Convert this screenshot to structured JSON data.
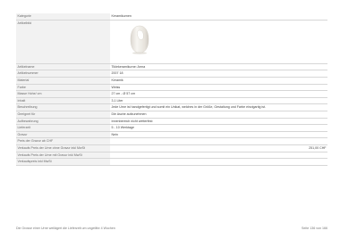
{
  "rows_top": [
    {
      "label": "Kategorie",
      "value": "Keramikurnen"
    },
    {
      "label": "Artikelbild",
      "value": ""
    }
  ],
  "rows": [
    {
      "label": "Artikelname",
      "value": "Tiklekeramikurne: Arma"
    },
    {
      "label": "Artikelnummer",
      "value": "2007 18"
    },
    {
      "label": "Material",
      "value": "Keramik"
    },
    {
      "label": "Farbe",
      "value": "Weiss"
    },
    {
      "label": "Masse Hohe/ cm",
      "value": "27 cm - Ø 57 cm"
    },
    {
      "label": "Inhalt",
      "value": "3,1 Liter"
    },
    {
      "label": "Beschreibung",
      "value": "Jede Urne ist handgefertigt und somit ein Unikat, welches in der Größe, Gestaltung und Farbe einzigartig ist."
    },
    {
      "label": "Geeignet für",
      "value": "Die Asche aufzunehmen"
    },
    {
      "label": "Aufbewahrung",
      "value": "Innenbereich nicht wetterfest"
    },
    {
      "label": "Lieferzeit",
      "value": "5 - 10 Werktage"
    },
    {
      "label": "Gravur",
      "value": "Nein"
    },
    {
      "label": "Preis der Gravur ab CHF",
      "value": ""
    },
    {
      "label": "Verkaufs Preis der Urne ohne Gravur inkl MwSt",
      "value": "251,00 CHF",
      "align": "right"
    },
    {
      "label": "Verkaufs Preis der Urne mit Gravur inkl MwSt",
      "value": ""
    },
    {
      "label": "Verkaufspreis inkl MwSt",
      "value": ""
    }
  ],
  "footer": {
    "note": "Die Grosse einer Urne weilägert die Lieferzeit um ungefähr 4 Wochen",
    "page": "Seite 136 von 166"
  },
  "colors": {
    "label_bg": "#f2f2f2",
    "rule": "#d6d6d6",
    "urn": "#f4f1ec"
  }
}
